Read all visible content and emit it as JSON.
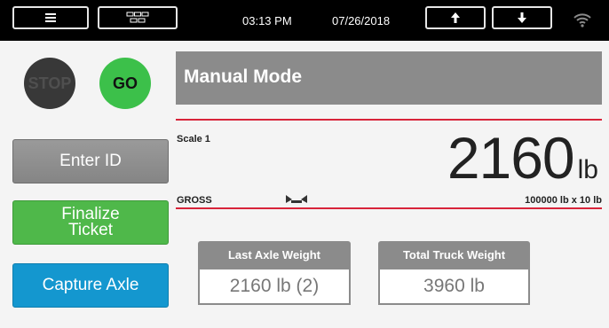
{
  "topbar": {
    "time": "03:13 PM",
    "date": "07/26/2018",
    "menu_icon": "hamburger-menu-icon",
    "grid_icon": "grid-layout-icon",
    "up_icon": "arrow-up-icon",
    "down_icon": "arrow-down-icon",
    "wifi_icon": "wifi-icon"
  },
  "controls": {
    "stop_label": "STOP",
    "go_label": "GO"
  },
  "main": {
    "mode_title": "Manual Mode",
    "scale_label": "Scale 1",
    "weight_value": "2160",
    "weight_unit": "lb",
    "gross_label": "GROSS",
    "capacity": "100000 lb x 10 lb"
  },
  "buttons": {
    "enter_id": "Enter ID",
    "finalize_line1": "Finalize",
    "finalize_line2": "Ticket",
    "capture_axle": "Capture Axle"
  },
  "panels": {
    "last_axle_title": "Last Axle Weight",
    "last_axle_value": "2160 lb (2)",
    "total_truck_title": "Total Truck Weight",
    "total_truck_value": "3960 lb"
  },
  "colors": {
    "top_bar": "#000000",
    "go": "#3cc04a",
    "stop": "#383838",
    "finalize": "#4fb84a",
    "capture": "#1497cf",
    "accent_line": "#d8243a",
    "panel_gray": "#8b8b8b"
  }
}
